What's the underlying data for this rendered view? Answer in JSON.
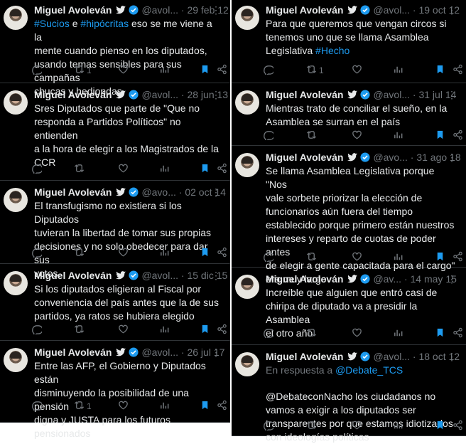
{
  "colors": {
    "background": "#000000",
    "text": "#e7e9ea",
    "muted": "#71767b",
    "accent": "#1d9bf0",
    "divider": "#2f3336"
  },
  "icons": [
    "verified-badge-icon",
    "twitter-bird-icon",
    "more-icon",
    "reply-icon",
    "retweet-icon",
    "like-icon",
    "views-icon",
    "bookmark-icon",
    "share-icon"
  ],
  "left_column": [
    {
      "name": "Miguel Avoleván",
      "handle": "@avol...",
      "date": "· 29 feb 12",
      "lines": [
        [
          "#Sucios",
          "hashtag"
        ],
        [
          " e ",
          ""
        ],
        [
          "#hipócritas",
          "hashtag"
        ],
        [
          " eso se me viene a la\nmente cuando pienso en los diputados,\nusando temas sensibles para sus campañas\nchucas y hediondas",
          ""
        ]
      ],
      "retweets": "1"
    },
    {
      "name": "Miguel Avoleván",
      "handle": "@avol...",
      "date": "· 28 jun 13",
      "lines": [
        [
          "Sres Diputados que parte de \"Que no\nresponda a Partidos Políticos\" no entienden\na la hora de elegir a los Magistrados de la\nCCR",
          ""
        ]
      ],
      "retweets": ""
    },
    {
      "name": "Miguel Avoleván",
      "handle": "@avo...",
      "date": "· 02 oct 14",
      "lines": [
        [
          "El transfugismo no existiera si los Diputados\ntuvieran la libertad de tomar sus propias\ndecisiones y no solo obedecer para dar sus\nvotos.",
          ""
        ]
      ],
      "retweets": ""
    },
    {
      "name": "Miguel Avoleván",
      "handle": "@avol...",
      "date": "· 15 dic 15",
      "lines": [
        [
          "Si los diputados eligieran al Fiscal por\nconveniencia del país antes que la de sus\npartidos, ya ratos se hubiera elegido",
          ""
        ]
      ],
      "retweets": ""
    },
    {
      "name": "Miguel Avoleván",
      "handle": "@avol...",
      "date": "· 26 jul 17",
      "lines": [
        [
          "Entre las AFP, el Gobierno y Diputados están\ndisminuyendo la posibilidad de una pensión\ndigna y JUSTA para los futuros pensionados",
          ""
        ]
      ],
      "retweets": "1"
    }
  ],
  "right_column": [
    {
      "name": "Miguel Avoleván",
      "handle": "@avol...",
      "date": "· 19 oct 12",
      "lines": [
        [
          "Para que queremos que vengan circos si\ntenemos uno que se llama Asamblea\nLegislativa ",
          ""
        ],
        [
          "#Hecho",
          "hashtag"
        ]
      ],
      "retweets": "1"
    },
    {
      "name": "Miguel Avoleván",
      "handle": "@avol...",
      "date": "· 31 jul 14",
      "lines": [
        [
          "Mientras trato de conciliar el sueño, en la\nAsamblea se surran en el país",
          ""
        ]
      ],
      "retweets": ""
    },
    {
      "name": "Miguel Avoleván",
      "handle": "@avo...",
      "date": "· 31 ago 18",
      "lines": [
        [
          "Se llama Asamblea Legislativa porque \"Nos\nvale sorbete priorizar la elección de\nfuncionarios aún fuera del tiempo\nestablecido porque primero están nuestros\nintereses y reparto de cuotas de poder antes\nde elegir a gente capacitada para el cargo\"\nera muy largo",
          ""
        ]
      ],
      "retweets": ""
    },
    {
      "name": "Miguel Avoleván",
      "handle": "@av...",
      "date": "· 14 may 15",
      "lines": [
        [
          "Increíble que alguien que entró casi de\nchiripa de diputado va a presidir la Asamblea\nel otro año",
          ""
        ]
      ],
      "retweets": ""
    },
    {
      "name": "Miguel Avoleván",
      "handle": "@avol...",
      "date": "· 18 oct 12",
      "reply_prefix": "En respuesta a ",
      "reply_to": "@Debate_TCS",
      "lines": [
        [
          "@DebateconNacho los ciudadanos no\nvamos a exigir a los diputados ser\ntransparentes por que estamos idiotizados\ncon ideologías políticas",
          ""
        ]
      ],
      "retweets": ""
    }
  ]
}
